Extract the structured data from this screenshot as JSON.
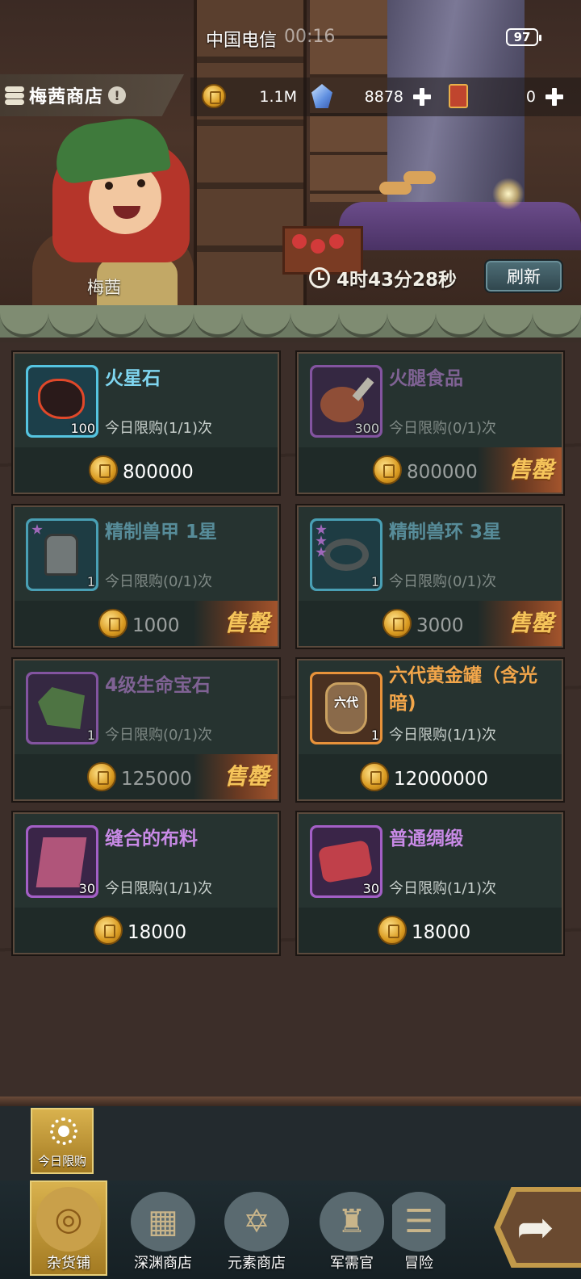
{
  "status_bar": {
    "carrier": "中国电信",
    "time": "00:16",
    "battery": "97"
  },
  "header": {
    "shop_title": "梅茜商店",
    "warning_glyph": "!",
    "currencies": [
      {
        "icon": "gold-coin-icon",
        "value": "1.1M"
      },
      {
        "icon": "crystal-icon",
        "value": "8878"
      },
      {
        "icon": "ticket-icon",
        "value": "0"
      }
    ]
  },
  "scene": {
    "npc_name": "梅茜",
    "timer": "4时43分28秒",
    "refresh_label": "刷新"
  },
  "items": [
    {
      "name": "火星石",
      "qty": "100",
      "limit": "今日限购(1/1)次",
      "price": "800000",
      "rarity": "blue",
      "soldout": false,
      "icon": "lava-stone-icon"
    },
    {
      "name": "火腿食品",
      "qty": "300",
      "limit": "今日限购(0/1)次",
      "price": "800000",
      "rarity": "purple",
      "soldout": true,
      "icon": "ham-icon"
    },
    {
      "name": "精制兽甲 1星",
      "qty": "1",
      "limit": "今日限购(0/1)次",
      "price": "1000",
      "rarity": "blue",
      "soldout": true,
      "icon": "beast-armor-icon"
    },
    {
      "name": "精制兽环 3星",
      "qty": "1",
      "limit": "今日限购(0/1)次",
      "price": "3000",
      "rarity": "blue",
      "soldout": true,
      "icon": "beast-ring-icon"
    },
    {
      "name": "4级生命宝石",
      "qty": "1",
      "limit": "今日限购(0/1)次",
      "price": "125000",
      "rarity": "purple",
      "soldout": true,
      "icon": "life-gem-icon"
    },
    {
      "name": "六代黄金罐（含光暗)",
      "qty": "1",
      "limit": "今日限购(1/1)次",
      "price": "12000000",
      "rarity": "orange",
      "soldout": false,
      "icon": "golden-jar-icon",
      "jar_text": "六代"
    },
    {
      "name": "缝合的布料",
      "qty": "30",
      "limit": "今日限购(1/1)次",
      "price": "18000",
      "rarity": "purple",
      "soldout": false,
      "icon": "cloth-icon"
    },
    {
      "name": "普通绸缎",
      "qty": "30",
      "limit": "今日限购(1/1)次",
      "price": "18000",
      "rarity": "purple",
      "soldout": false,
      "icon": "silk-icon"
    }
  ],
  "soldout_label": "售罄",
  "sub_tab": {
    "label": "今日限购",
    "icon": "sun-icon"
  },
  "bottom_nav": [
    {
      "label": "杂货铺",
      "icon": "coins-icon",
      "active": true
    },
    {
      "label": "深渊商店",
      "icon": "crates-icon",
      "active": false
    },
    {
      "label": "元素商店",
      "icon": "hexagram-icon",
      "active": false
    },
    {
      "label": "军需官",
      "icon": "helmet-icon",
      "active": false
    },
    {
      "label": "冒险",
      "icon": "scroll-icon",
      "active": false
    }
  ],
  "colors": {
    "rarity_blue": "#55c4e0",
    "rarity_purple": "#a35fc6",
    "rarity_orange": "#e8923a",
    "soldout_text": "#f5c45a"
  }
}
